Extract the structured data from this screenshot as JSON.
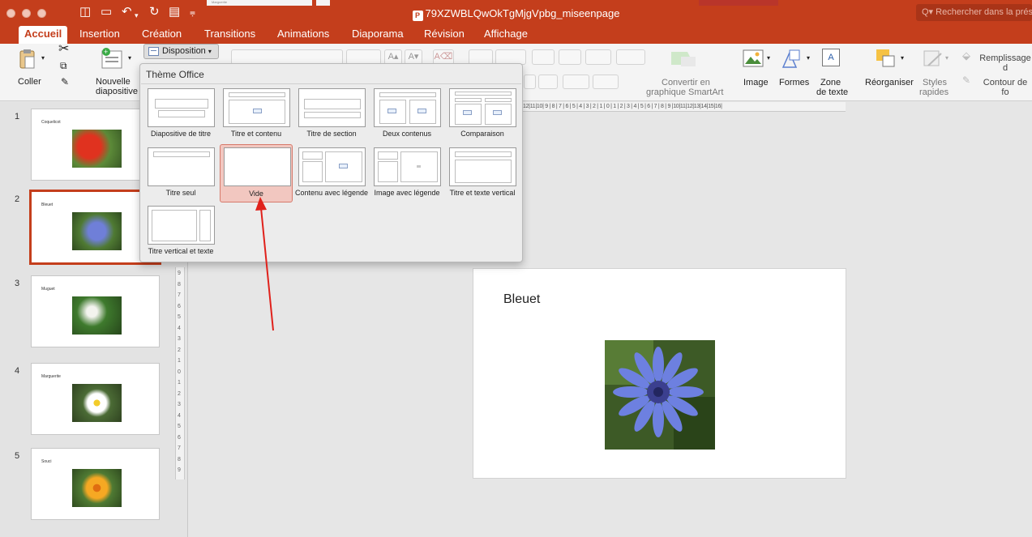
{
  "window": {
    "title": "79XZWBLQwOkTgMjgVpbg_miseenpage",
    "search_placeholder": "Rechercher dans la prés",
    "peek_text": "Marguerite"
  },
  "tabs": [
    {
      "label": "Accueil",
      "active": true
    },
    {
      "label": "Insertion"
    },
    {
      "label": "Création"
    },
    {
      "label": "Transitions"
    },
    {
      "label": "Animations"
    },
    {
      "label": "Diaporama"
    },
    {
      "label": "Révision"
    },
    {
      "label": "Affichage"
    }
  ],
  "ribbon": {
    "coller": "Coller",
    "nouvelle_line1": "Nouvelle",
    "nouvelle_line2": "diapositive",
    "disposition": "Disposition",
    "smartart_line1": "Convertir en",
    "smartart_line2": "graphique SmartArt",
    "image": "Image",
    "formes": "Formes",
    "zone_line1": "Zone",
    "zone_line2": "de texte",
    "reorganiser": "Réorganiser",
    "styles_line1": "Styles",
    "styles_line2": "rapides",
    "remplissage": "Remplissage d",
    "contour": "Contour de fo"
  },
  "layout_popup": {
    "title": "Thème Office",
    "items": [
      {
        "label": "Diapositive de titre"
      },
      {
        "label": "Titre et contenu"
      },
      {
        "label": "Titre de section"
      },
      {
        "label": "Deux contenus"
      },
      {
        "label": "Comparaison"
      },
      {
        "label": "Titre seul"
      },
      {
        "label": "Vide",
        "highlighted": true
      },
      {
        "label": "Contenu avec légende"
      },
      {
        "label": "Image avec légende"
      },
      {
        "label": "Titre et texte vertical"
      },
      {
        "label": "Titre vertical et texte"
      }
    ]
  },
  "slides": [
    {
      "number": "1",
      "title": "Coquelicot",
      "color": "#d6311f"
    },
    {
      "number": "2",
      "title": "Bleuet",
      "color": "#6f7fd8",
      "selected": true
    },
    {
      "number": "3",
      "title": "Muguet",
      "color": "#f3f3ee"
    },
    {
      "number": "4",
      "title": "Marguerite",
      "color": "#f6f6f0"
    },
    {
      "number": "5",
      "title": "Souci",
      "color": "#f2a21c"
    }
  ],
  "current_slide": {
    "title": "Bleuet"
  },
  "rulers": {
    "horizontal": "12|11|10| 9 | 8 | 7 | 6 | 5 | 4 | 3 | 2 | 1 | 0 | 1 | 2 | 3 | 4 | 5 | 6 | 7 | 8 | 9 |10|11|12|13|14|15|16|",
    "vertical": [
      "9",
      "8",
      "7",
      "6",
      "5",
      "4",
      "3",
      "2",
      "1",
      "0",
      "1",
      "2",
      "3",
      "4",
      "5",
      "6",
      "7",
      "8",
      "9"
    ]
  },
  "colors": {
    "accent": "#c43e1c",
    "highlight": "#f2c7c0",
    "arrow": "#e0211b"
  }
}
